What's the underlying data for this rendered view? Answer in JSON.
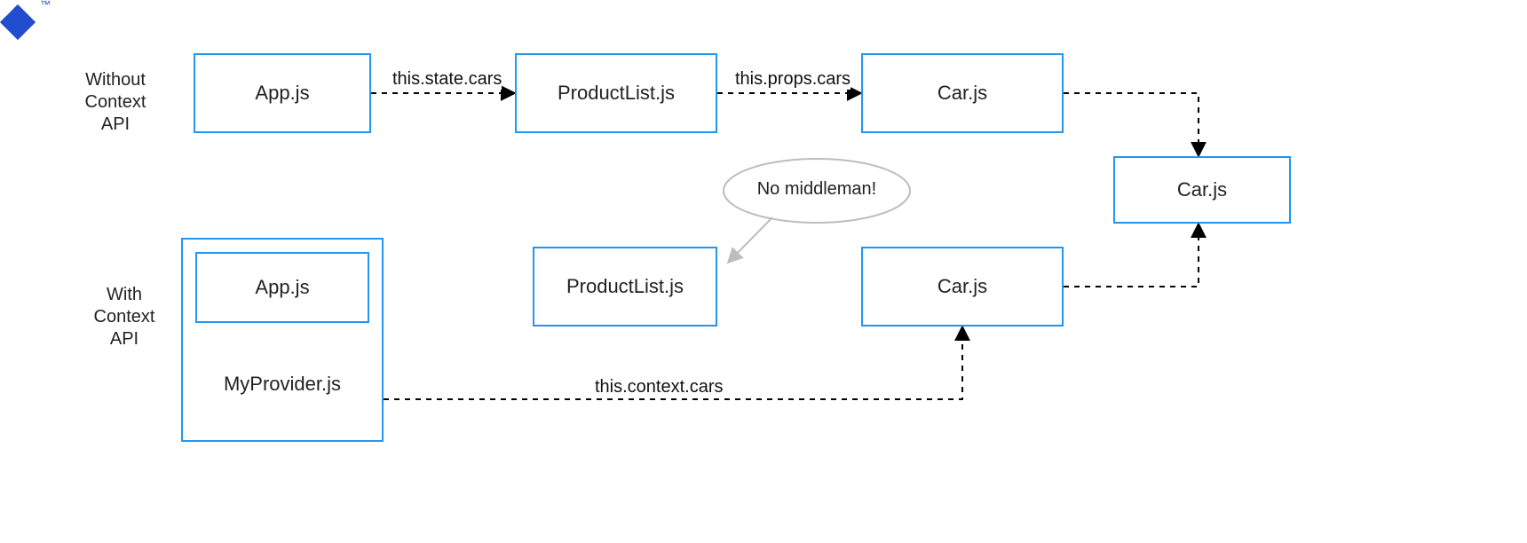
{
  "logo_tm": "™",
  "sections": {
    "without": {
      "l1": "Without",
      "l2": "Context",
      "l3": "API"
    },
    "with": {
      "l1": "With",
      "l2": "Context",
      "l3": "API"
    }
  },
  "top": {
    "app": "App.js",
    "productList": "ProductList.js",
    "car": "Car.js",
    "edge_state": "this.state.cars",
    "edge_props": "this.props.cars"
  },
  "merge": {
    "car": "Car.js"
  },
  "bottom": {
    "innerApp": "App.js",
    "provider": "MyProvider.js",
    "productList": "ProductList.js",
    "car": "Car.js",
    "edge_context": "this.context.cars",
    "callout": "No middleman!"
  },
  "colors": {
    "accent": "#2196f3",
    "gray": "#bdbdbd"
  }
}
